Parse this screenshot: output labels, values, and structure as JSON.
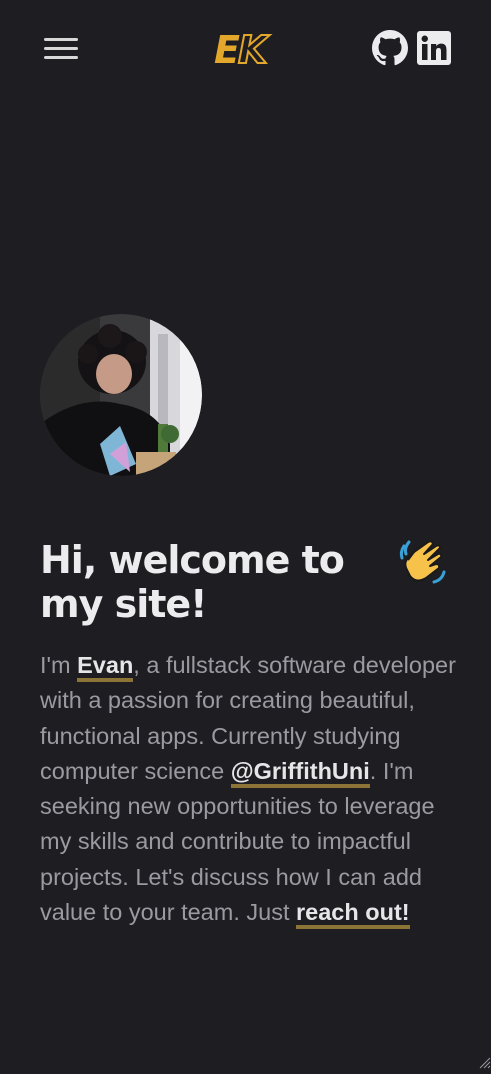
{
  "header": {
    "menu_icon": "hamburger-menu-icon",
    "logo_letter_1": "E",
    "logo_letter_2": "K",
    "github_icon": "github-icon",
    "linkedin_icon": "linkedin-icon"
  },
  "hero": {
    "title": "Hi, welcome to my site!",
    "wave_icon": "waving-hand-icon",
    "bio": {
      "t1": "I'm ",
      "name_link": "Evan",
      "t2": ", a fullstack software developer with a passion for creating beautiful, functional apps. Currently studying computer science ",
      "uni_link": "@GriffithUni",
      "t3": ". I'm seeking new opportunities to leverage my skills and contribute to impactful projects. Let's discuss how I can add value to your team. Just ",
      "contact_link": "reach out!"
    }
  },
  "colors": {
    "background": "#1e1e22",
    "accent": "#e3a82b",
    "link_underline": "#8c7336",
    "heading": "#ececef",
    "body_text": "#9a9aa0"
  }
}
